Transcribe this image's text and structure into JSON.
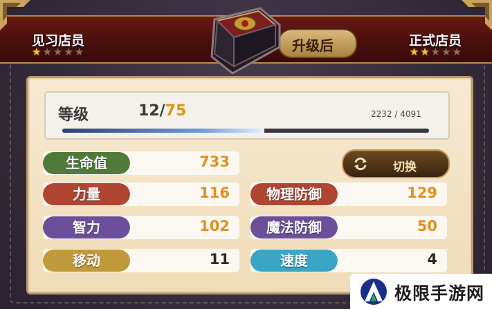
{
  "header": {
    "current_rank": "见习店员",
    "current_stars": {
      "filled": 1,
      "total": 5
    },
    "upgrade_label": "升级后",
    "next_rank": "正式店员",
    "next_stars": {
      "filled": 2,
      "total": 5
    }
  },
  "level": {
    "label": "等级",
    "current": "12",
    "separator": "/",
    "max": "75",
    "exp_text": "2232 / 4091",
    "exp_progress": 0.55
  },
  "switch_button": {
    "label": "切换",
    "icon": "refresh-icon"
  },
  "stats_left": [
    {
      "label": "生命值",
      "value": "733",
      "label_color": "#4f7a3a",
      "value_style": "orange"
    },
    {
      "label": "力量",
      "value": "116",
      "label_color": "#b04532",
      "value_style": "orange"
    },
    {
      "label": "智力",
      "value": "102",
      "label_color": "#6b4f9a",
      "value_style": "orange"
    },
    {
      "label": "移动",
      "value": "11",
      "label_color": "#c09a3a",
      "value_style": "dark"
    }
  ],
  "stats_right": [
    {
      "label": "物理防御",
      "value": "129",
      "label_color": "#b04532",
      "value_style": "orange"
    },
    {
      "label": "魔法防御",
      "value": "50",
      "label_color": "#6b4f9a",
      "value_style": "orange"
    },
    {
      "label": "速度",
      "value": "4",
      "label_color": "#3aa6c6",
      "value_style": "dark"
    }
  ],
  "watermark": {
    "text": "极限手游网"
  },
  "colors": {
    "accent_orange": "#e48f1c",
    "banner_red": "#5a1410",
    "gold_trim": "#b58a4a",
    "star_filled": "#f2c23c",
    "star_empty": "#7d7468"
  }
}
